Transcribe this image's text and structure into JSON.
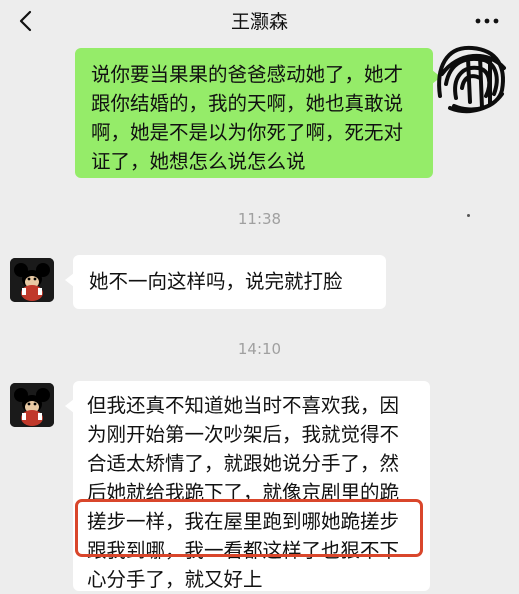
{
  "header": {
    "title": "王灏森",
    "back_icon": "chevron-left-icon",
    "more_icon": "more-horizontal-icon"
  },
  "messages": [
    {
      "direction": "out",
      "text": "说你要当果果的爸爸感动她了，她才跟你结婚的，我的天啊，她也真敢说啊，她是不是以为你死了啊，死无对证了，她想怎么说怎么说"
    },
    {
      "timestamp": "11:38"
    },
    {
      "direction": "in",
      "text": "她不一向这样吗，说完就打脸"
    },
    {
      "timestamp": "14:10"
    },
    {
      "direction": "in",
      "text": "但我还真不知道她当时不喜欢我，因为刚开始第一次吵架后，我就觉得不合适太矫情了，就跟她说分手了，然后她就给我跪下了，就像京剧里的跪搓步一样，我在屋里跑到哪她跪搓步跟我到哪，我一看都这样了也狠不下心分手了，就又好上"
    }
  ],
  "colors": {
    "background": "#ededed",
    "outgoing_bubble": "#95ec69",
    "incoming_bubble": "#ffffff",
    "highlight_border": "#d9462b"
  }
}
